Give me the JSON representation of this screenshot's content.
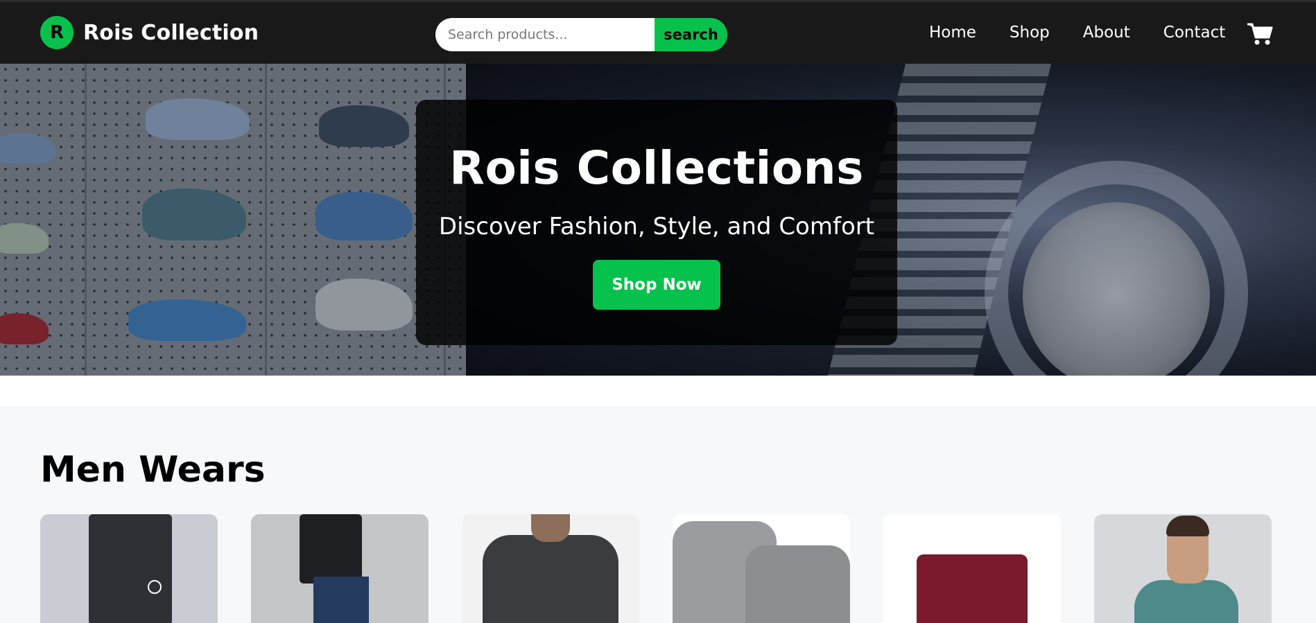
{
  "brand": {
    "logo_letter": "R",
    "name": "Rois Collection"
  },
  "search": {
    "placeholder": "Search products...",
    "button_label": "search"
  },
  "nav": {
    "links": [
      "Home",
      "Shop",
      "About",
      "Contact"
    ],
    "cart_icon": "shopping-cart-icon"
  },
  "hero": {
    "title": "Rois Collections",
    "subtitle": "Discover Fashion, Style, and Comfort",
    "cta_label": "Shop Now"
  },
  "section": {
    "title": "Men Wears"
  },
  "products": [
    {
      "image": "men-cargo-pants"
    },
    {
      "image": "men-black-hoodie-outfit"
    },
    {
      "image": "men-denim-jacket"
    },
    {
      "image": "men-grey-polo-shirts"
    },
    {
      "image": "men-maroon-shorts"
    },
    {
      "image": "men-teal-polo"
    }
  ],
  "colors": {
    "accent": "#06c24c",
    "navbar": "#191919",
    "page_bg": "#f7f8fa"
  }
}
